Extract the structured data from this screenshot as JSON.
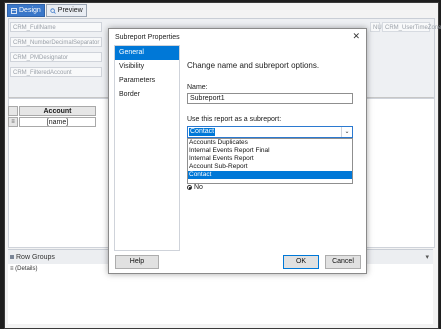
{
  "designer": {
    "tabs": [
      {
        "label": "Design",
        "active": true
      },
      {
        "label": "Preview",
        "active": false
      }
    ],
    "fields_left": [
      "CRM_FullName",
      "CRM_NumberDecimalSeparator",
      "CRM_PMDesignator",
      "CRM_FilteredAccount"
    ],
    "fields_right": [
      "NULL",
      "CRM_UserTimeZoneName"
    ],
    "table": {
      "header": "Account",
      "cell": "[name]"
    },
    "groups": {
      "title": "Row Groups",
      "item": "(Details)"
    }
  },
  "dialog": {
    "title": "Subreport Properties",
    "close_glyph": "✕",
    "nav_items": [
      {
        "label": "General",
        "selected": true
      },
      {
        "label": "Visibility",
        "selected": false
      },
      {
        "label": "Parameters",
        "selected": false
      },
      {
        "label": "Border",
        "selected": false
      }
    ],
    "heading": "Change name and subreport options.",
    "name_label": "Name:",
    "name_value": "Subreport1",
    "use_label": "Use this report as a subreport:",
    "combo_value": "Contact",
    "options": [
      {
        "label": "Accounts Duplicates",
        "selected": false
      },
      {
        "label": "Internal Events Report Final",
        "selected": false
      },
      {
        "label": "Internal Events Report",
        "selected": false
      },
      {
        "label": "Account Sub-Report",
        "selected": false
      },
      {
        "label": "Contact",
        "selected": true
      }
    ],
    "radio_no_label": "No",
    "buttons": {
      "help": "Help",
      "ok": "OK",
      "cancel": "Cancel"
    }
  },
  "colors": {
    "accent": "#0078d7",
    "design_tab": "#3a77c9"
  }
}
